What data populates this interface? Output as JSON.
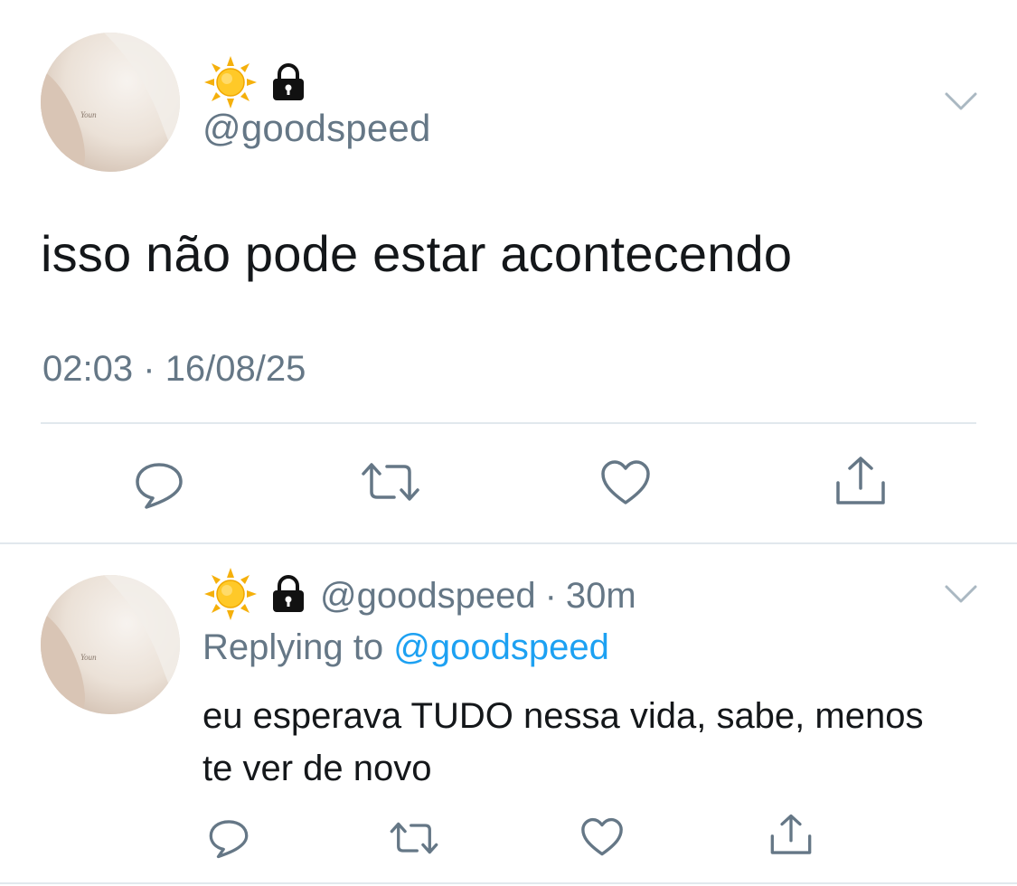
{
  "tweet": {
    "handle": "@goodspeed",
    "text": "isso não pode estar acontecendo",
    "time": "02:03",
    "separator": "·",
    "date": "16/08/25",
    "icons": [
      "sun-icon",
      "lock-icon",
      "chevron-down-icon"
    ]
  },
  "actions": [
    "reply-icon",
    "retweet-icon",
    "like-icon",
    "share-icon"
  ],
  "reply": {
    "handle": "@goodspeed",
    "separator": "·",
    "time": "30m",
    "replying_prefix": "Replying to",
    "replying_to": "@goodspeed",
    "text": "eu esperava TUDO nessa vida, sabe, menos te ver de novo"
  },
  "colors": {
    "text": "#14171a",
    "secondary": "#657786",
    "link": "#1da1f2",
    "divider": "#e1e8ed"
  }
}
